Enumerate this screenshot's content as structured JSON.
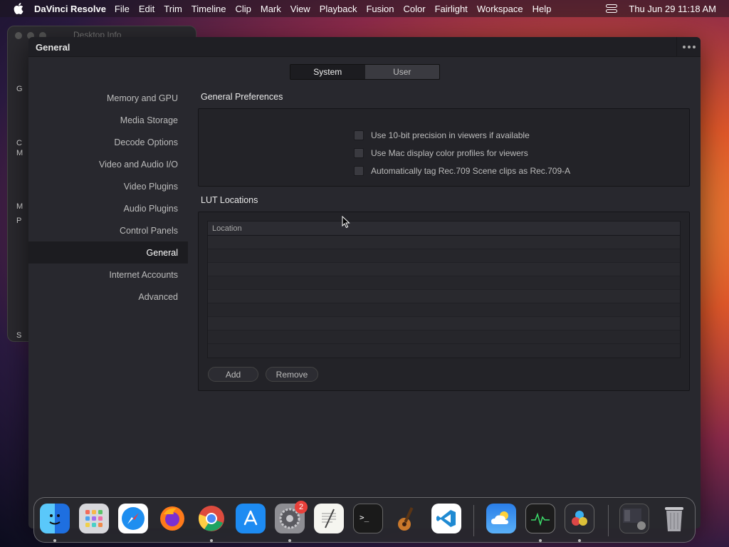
{
  "menubar": {
    "app_name": "DaVinci Resolve",
    "items": [
      "File",
      "Edit",
      "Trim",
      "Timeline",
      "Clip",
      "Mark",
      "View",
      "Playback",
      "Fusion",
      "Color",
      "Fairlight",
      "Workspace",
      "Help"
    ],
    "datetime": "Thu Jun 29  11:18 AM"
  },
  "finder_window": {
    "title": "Desktop Info",
    "side_items": [
      "G",
      "C",
      "M",
      "M",
      "P",
      "S"
    ]
  },
  "window": {
    "title": "General",
    "tabs": [
      {
        "label": "System",
        "active": true
      },
      {
        "label": "User",
        "active": false
      }
    ],
    "sidebar": [
      {
        "label": "Memory and GPU",
        "selected": false
      },
      {
        "label": "Media Storage",
        "selected": false
      },
      {
        "label": "Decode Options",
        "selected": false
      },
      {
        "label": "Video and Audio I/O",
        "selected": false
      },
      {
        "label": "Video Plugins",
        "selected": false
      },
      {
        "label": "Audio Plugins",
        "selected": false
      },
      {
        "label": "Control Panels",
        "selected": false
      },
      {
        "label": "General",
        "selected": true
      },
      {
        "label": "Internet Accounts",
        "selected": false
      },
      {
        "label": "Advanced",
        "selected": false
      }
    ],
    "general_preferences": {
      "heading": "General Preferences",
      "options": [
        {
          "label": "Use 10-bit precision in viewers if available",
          "checked": false
        },
        {
          "label": "Use Mac display color profiles for viewers",
          "checked": false
        },
        {
          "label": "Automatically tag Rec.709 Scene clips as Rec.709-A",
          "checked": false
        }
      ]
    },
    "lut_locations": {
      "heading": "LUT Locations",
      "column_header": "Location",
      "rows": [],
      "add_label": "Add",
      "remove_label": "Remove"
    }
  },
  "dock": {
    "apps": [
      {
        "name": "Finder",
        "icon": "finder-icon",
        "running": true
      },
      {
        "name": "Launchpad",
        "icon": "launchpad-icon",
        "running": false
      },
      {
        "name": "Safari",
        "icon": "safari-icon",
        "running": false
      },
      {
        "name": "Firefox",
        "icon": "firefox-icon",
        "running": false
      },
      {
        "name": "Chrome",
        "icon": "chrome-icon",
        "running": true
      },
      {
        "name": "App Store",
        "icon": "app-store-icon",
        "running": false
      },
      {
        "name": "System Settings",
        "icon": "system-settings-icon",
        "running": true,
        "badge": "2"
      },
      {
        "name": "TextEdit",
        "icon": "textedit-icon",
        "running": false
      },
      {
        "name": "Terminal",
        "icon": "terminal-icon",
        "running": false
      },
      {
        "name": "GarageBand",
        "icon": "garageband-icon",
        "running": false
      },
      {
        "name": "Visual Studio Code",
        "icon": "vscode-icon",
        "running": false
      },
      {
        "name": "Weather",
        "icon": "weather-icon",
        "running": false
      },
      {
        "name": "Activity Monitor",
        "icon": "activity-monitor-icon",
        "running": true
      },
      {
        "name": "DaVinci Resolve",
        "icon": "davinci-resolve-icon",
        "running": true
      },
      {
        "name": "Downloads",
        "icon": "downloads-stack-icon",
        "running": false
      },
      {
        "name": "Trash",
        "icon": "trash-icon",
        "running": false
      }
    ]
  },
  "colors": {
    "window_bg": "#28282e",
    "sidebar_selected_bg": "#1c1c20",
    "text": "#bcbcbc",
    "badge": "#e8403a"
  }
}
